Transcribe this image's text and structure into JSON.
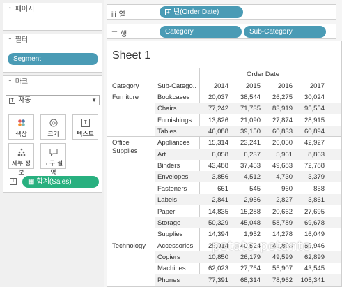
{
  "pages": {
    "title": "페이지"
  },
  "filters": {
    "title": "필터",
    "pill": "Segment"
  },
  "marks": {
    "title": "마크",
    "type": "자동",
    "buttons": [
      "색상",
      "크기",
      "텍스트",
      "세부 정보",
      "도구 설명"
    ],
    "measure_pill": "합계(Sales)"
  },
  "columns": {
    "label": "열",
    "pill": "년(Order Date)"
  },
  "rows": {
    "label": "행",
    "pills": [
      "Category",
      "Sub-Category"
    ]
  },
  "sheet": {
    "title": "Sheet 1",
    "header_group": "Order Date",
    "col_category": "Category",
    "col_subcategory": "Sub-Catego..",
    "years": [
      "2014",
      "2015",
      "2016",
      "2017"
    ],
    "categories": [
      {
        "name": "Furniture",
        "rows": [
          {
            "sub": "Bookcases",
            "v": [
              "20,037",
              "38,544",
              "26,275",
              "30,024"
            ]
          },
          {
            "sub": "Chairs",
            "v": [
              "77,242",
              "71,735",
              "83,919",
              "95,554"
            ]
          },
          {
            "sub": "Furnishings",
            "v": [
              "13,826",
              "21,090",
              "27,874",
              "28,915"
            ]
          },
          {
            "sub": "Tables",
            "v": [
              "46,088",
              "39,150",
              "60,833",
              "60,894"
            ]
          }
        ]
      },
      {
        "name": "Office Supplies",
        "rows": [
          {
            "sub": "Appliances",
            "v": [
              "15,314",
              "23,241",
              "26,050",
              "42,927"
            ]
          },
          {
            "sub": "Art",
            "v": [
              "6,058",
              "6,237",
              "5,961",
              "8,863"
            ]
          },
          {
            "sub": "Binders",
            "v": [
              "43,488",
              "37,453",
              "49,683",
              "72,788"
            ]
          },
          {
            "sub": "Envelopes",
            "v": [
              "3,856",
              "4,512",
              "4,730",
              "3,379"
            ]
          },
          {
            "sub": "Fasteners",
            "v": [
              "661",
              "545",
              "960",
              "858"
            ]
          },
          {
            "sub": "Labels",
            "v": [
              "2,841",
              "2,956",
              "2,827",
              "3,861"
            ]
          },
          {
            "sub": "Paper",
            "v": [
              "14,835",
              "15,288",
              "20,662",
              "27,695"
            ]
          },
          {
            "sub": "Storage",
            "v": [
              "50,329",
              "45,048",
              "58,789",
              "69,678"
            ]
          },
          {
            "sub": "Supplies",
            "v": [
              "14,394",
              "1,952",
              "14,278",
              "16,049"
            ]
          }
        ]
      },
      {
        "name": "Technology",
        "rows": [
          {
            "sub": "Accessories",
            "v": [
              "25,014",
              "40,524",
              "41,893",
              "59,946"
            ]
          },
          {
            "sub": "Copiers",
            "v": [
              "10,850",
              "26,179",
              "49,599",
              "62,899"
            ]
          },
          {
            "sub": "Machines",
            "v": [
              "62,023",
              "27,764",
              "55,907",
              "43,545"
            ]
          },
          {
            "sub": "Phones",
            "v": [
              "77,391",
              "68,314",
              "78,962",
              "105,341"
            ]
          }
        ]
      }
    ]
  },
  "watermark": "potato-potanto"
}
